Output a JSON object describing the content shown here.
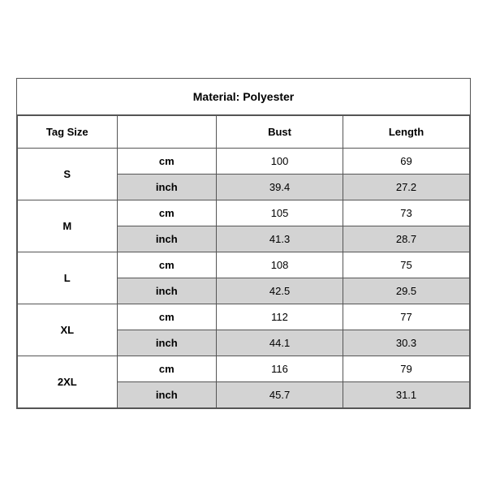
{
  "title": "Material: Polyester",
  "headers": {
    "tag_size": "Tag Size",
    "bust": "Bust",
    "length": "Length"
  },
  "sizes": [
    {
      "tag": "S",
      "cm": {
        "bust": "100",
        "length": "69"
      },
      "inch": {
        "bust": "39.4",
        "length": "27.2"
      }
    },
    {
      "tag": "M",
      "cm": {
        "bust": "105",
        "length": "73"
      },
      "inch": {
        "bust": "41.3",
        "length": "28.7"
      }
    },
    {
      "tag": "L",
      "cm": {
        "bust": "108",
        "length": "75"
      },
      "inch": {
        "bust": "42.5",
        "length": "29.5"
      }
    },
    {
      "tag": "XL",
      "cm": {
        "bust": "112",
        "length": "77"
      },
      "inch": {
        "bust": "44.1",
        "length": "30.3"
      }
    },
    {
      "tag": "2XL",
      "cm": {
        "bust": "116",
        "length": "79"
      },
      "inch": {
        "bust": "45.7",
        "length": "31.1"
      }
    }
  ],
  "units": {
    "cm": "cm",
    "inch": "inch"
  }
}
